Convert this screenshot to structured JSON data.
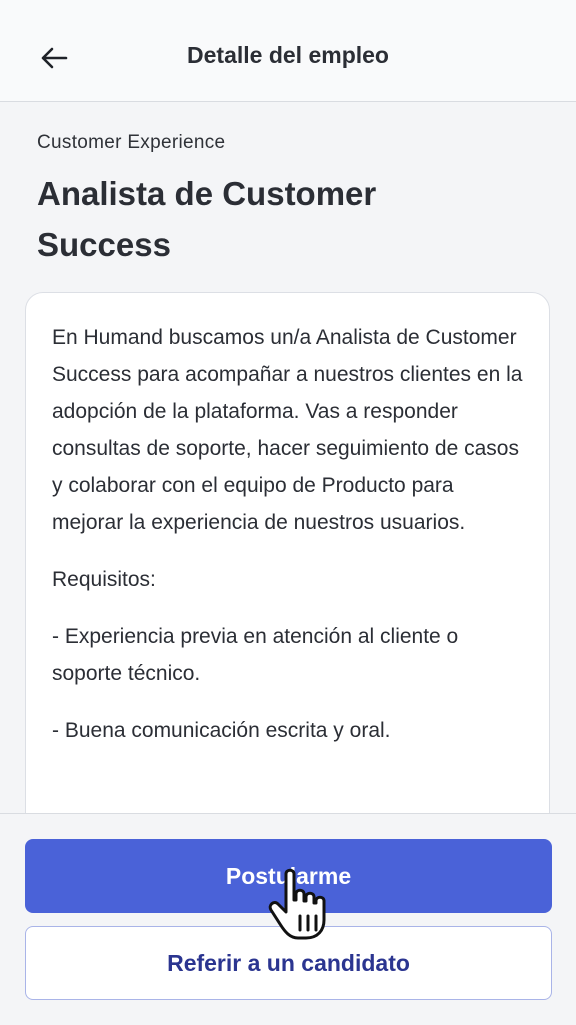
{
  "header": {
    "title": "Detalle del empleo",
    "back_icon": "arrow-left-icon"
  },
  "job": {
    "category": "Customer Experience",
    "title": "Analista de Customer Success",
    "description": [
      "En Humand buscamos un/a Analista de Customer Success para acompañar a nuestros clientes en la adopción de la plataforma. Vas a responder consultas de soporte, hacer seguimiento de casos y colaborar con el equipo de Producto para mejorar la experiencia de nuestros usuarios.",
      "Requisitos:",
      "- Experiencia previa en atención al cliente o soporte técnico.",
      "- Buena comunicación escrita y oral."
    ]
  },
  "actions": {
    "apply_label": "Postularme",
    "refer_label": "Referir a un candidato"
  },
  "colors": {
    "primary": "#4a62d8",
    "secondary_text": "#2b3590"
  },
  "cursor_icon": "hand-pointer-icon"
}
